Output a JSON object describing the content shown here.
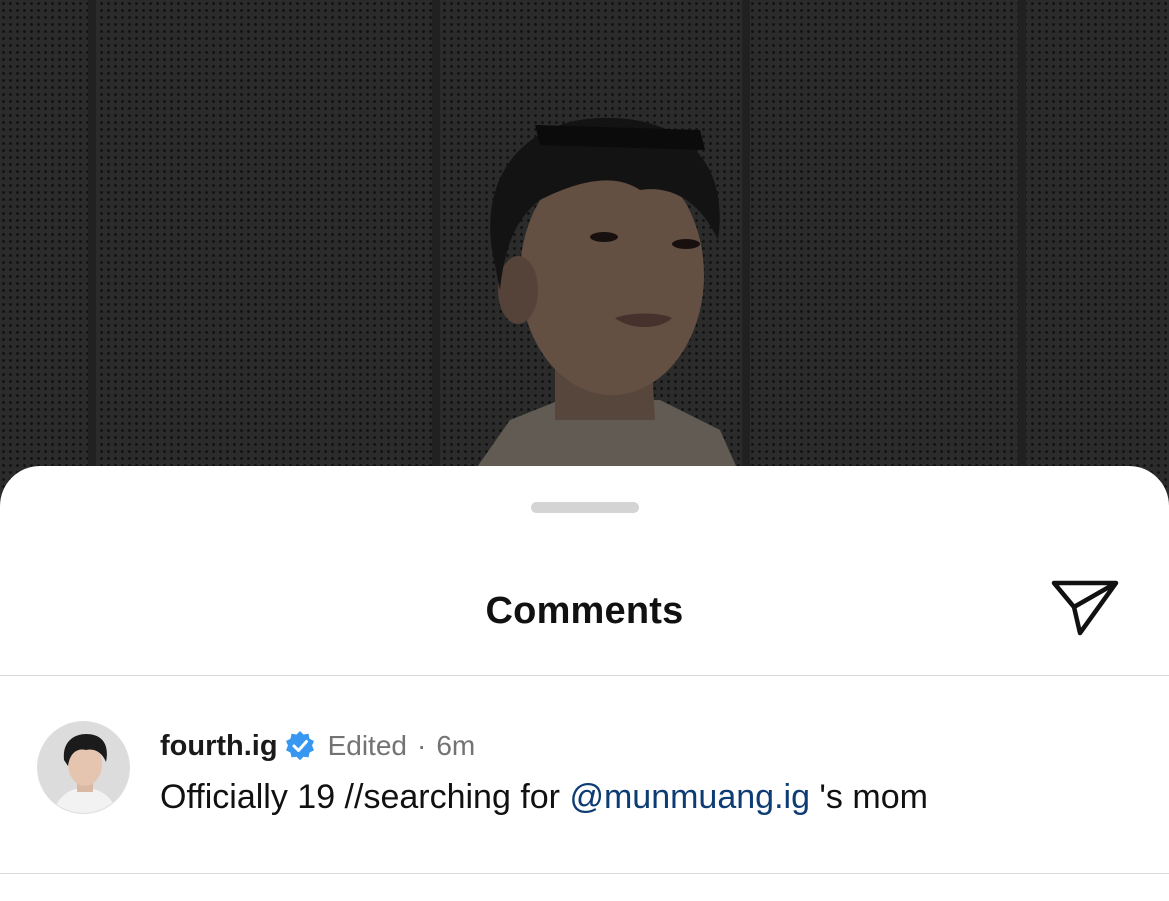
{
  "sheet": {
    "title": "Comments"
  },
  "comment": {
    "username": "fourth.ig",
    "edited": "Edited",
    "separator": "·",
    "time": "6m",
    "text_before": "Officially 19 //searching for ",
    "mention": "@munmuang.ig",
    "text_after": " 's mom"
  },
  "icons": {
    "share": "paper-plane-icon",
    "verified": "verified-badge-icon"
  },
  "colors": {
    "sheet_background": "#ffffff",
    "verified_blue": "#3897f0",
    "mention_blue": "#0d3c74",
    "secondary_text": "#737373"
  }
}
